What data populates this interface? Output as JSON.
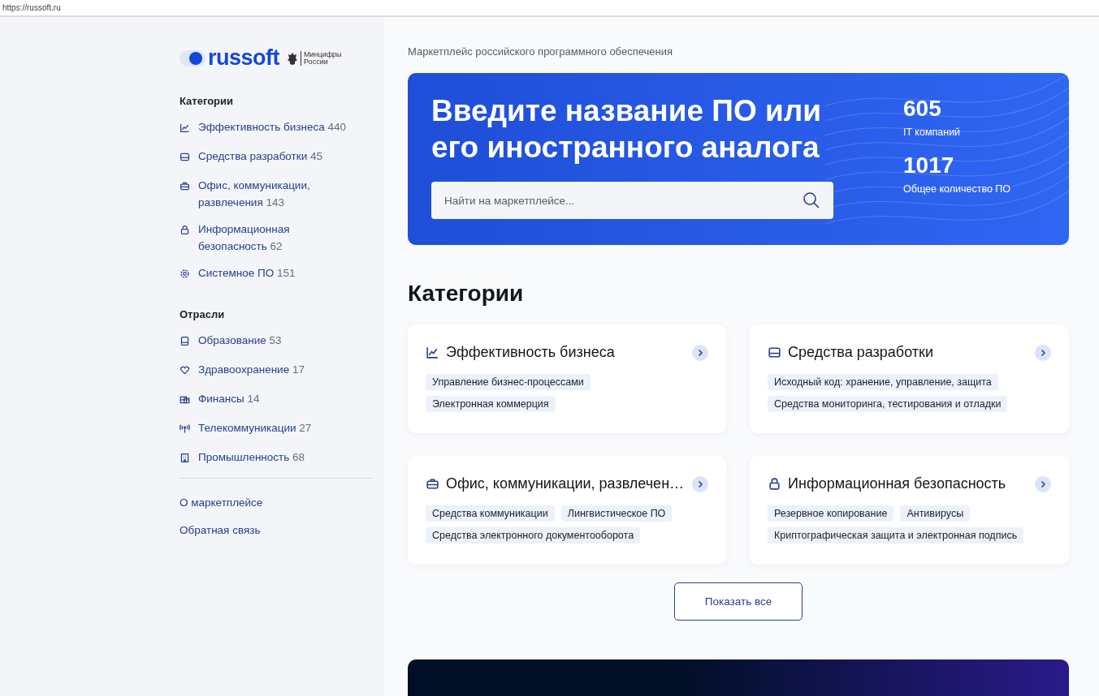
{
  "address_bar": {
    "url": "https://russoft.ru"
  },
  "logo": {
    "wordmark": "russoft",
    "partner_line_1": "Минцифры",
    "partner_line_2": "России"
  },
  "sidebar": {
    "sections": [
      {
        "title": "Категории",
        "items": [
          {
            "label": "Эффективность бизнеса",
            "count": "440"
          },
          {
            "label": "Средства разработки",
            "count": "45"
          },
          {
            "label": "Офис, коммуникации, развлечения",
            "count": "143"
          },
          {
            "label": "Информационная безопасность",
            "count": "62"
          },
          {
            "label": "Системное ПО",
            "count": "151"
          }
        ]
      },
      {
        "title": "Отрасли",
        "items": [
          {
            "label": "Образование",
            "count": "53"
          },
          {
            "label": "Здравоохранение",
            "count": "17"
          },
          {
            "label": "Финансы",
            "count": "14"
          },
          {
            "label": "Телекоммуникации",
            "count": "27"
          },
          {
            "label": "Промышленность",
            "count": "68"
          }
        ]
      }
    ],
    "links": [
      "О маркетплейсе",
      "Обратная связь"
    ]
  },
  "subtitle": "Маркетплейс российского программного обеспечения",
  "hero": {
    "title": "Введите название ПО или его иностранного аналога",
    "search": {
      "placeholder": "Найти на маркетплейсе..."
    },
    "stats": [
      {
        "value": "605",
        "label": "IT компаний"
      },
      {
        "value": "1017",
        "label": "Общее количество ПО"
      }
    ]
  },
  "categories": {
    "title": "Категории",
    "cards": [
      {
        "title": "Эффективность бизнеса",
        "tags": [
          "Управление бизнес-процессами",
          "Электронная коммерция"
        ]
      },
      {
        "title": "Средства разработки",
        "tags": [
          "Исходный код: хранение, управление, защита",
          "Средства мониторинга, тестирования и отладки"
        ]
      },
      {
        "title": "Офис, коммуникации, развлечен…",
        "tags": [
          "Средства коммуникации",
          "Лингвистическое ПО",
          "Средства электронного документооборота"
        ]
      },
      {
        "title": "Информационная безопасность",
        "tags": [
          "Резервное копирование",
          "Антивирусы",
          "Криптографическая защита и электронная подпись"
        ]
      }
    ],
    "show_all": "Показать все"
  }
}
